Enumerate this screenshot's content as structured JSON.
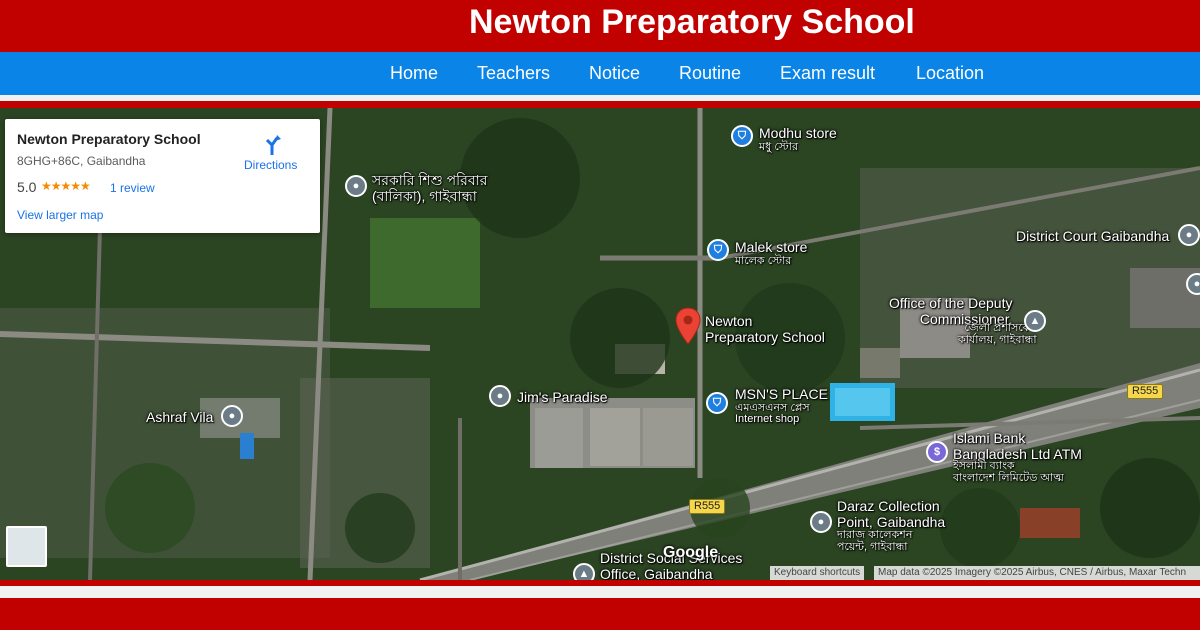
{
  "header": {
    "title": "Newton Preparatory School"
  },
  "nav": {
    "items": [
      "Home",
      "Teachers",
      "Notice",
      "Routine",
      "Exam result",
      "Location"
    ]
  },
  "colors": {
    "header_red": "#c10000",
    "nav_blue": "#0a84e6",
    "link_blue": "#1a73e8",
    "star_orange": "#f58b00",
    "pin_red": "#ea4335"
  },
  "infobox": {
    "name": "Newton Preparatory School",
    "address": "8GHG+86C, Gaibandha",
    "rating": "5.0",
    "stars": "★★★★★",
    "reviews": "1 review",
    "larger_map": "View larger map",
    "directions": "Directions",
    "directions_icon": "directions-icon"
  },
  "map": {
    "places": {
      "modhu_store": {
        "name": "Modhu store",
        "sub": "মধু স্টোর",
        "icon": "shopping-icon"
      },
      "sarkari": {
        "name": "সরকারি শিশু পরিবার\n(বালিকা), গাইবান্ধা",
        "icon": "place-icon"
      },
      "malek_store": {
        "name": "Malek store",
        "sub": "মালেক স্টোর",
        "icon": "shopping-icon"
      },
      "district_court": {
        "name": "District Court Gaibandha",
        "icon": "place-icon"
      },
      "deputy_commissioner": {
        "name": "Office of the Deputy\nCommissioner,",
        "sub": "জেলা প্রশাসকের\nকার্যালয়, গাইবান্ধা",
        "icon": "government-icon"
      },
      "newton": {
        "name": "Newton\nPreparatory School",
        "icon": "red-marker-icon"
      },
      "jims_paradise": {
        "name": "Jim's Paradise",
        "icon": "place-icon"
      },
      "msns_place": {
        "name": "MSN'S PLACE",
        "sub": "এমএসএনস প্লেস",
        "sub2": "Internet shop",
        "icon": "shopping-icon"
      },
      "ashraf_vila": {
        "name": "Ashraf Vila",
        "icon": "place-icon"
      },
      "islami_bank": {
        "name": "Islami Bank\nBangladesh Ltd ATM",
        "sub": "ইসলামী ব্যাংক\nবাংলাদেশ লিমিটেড আত্ম",
        "icon": "atm-icon"
      },
      "daraz": {
        "name": "Daraz Collection\nPoint, Gaibandha",
        "sub": "দারাজ কালেকশন\nপয়েন্ট, গাইবান্ধা",
        "icon": "place-icon"
      },
      "district_social": {
        "name": "District Social Services\nOffice, Gaibandha",
        "icon": "government-icon"
      }
    },
    "roads": {
      "r555_a": "R555",
      "r555_b": "R555"
    },
    "google_logo": "Google",
    "keyboard_shortcuts": "Keyboard shortcuts",
    "map_data": "Map data ©2025 Imagery ©2025 Airbus, CNES / Airbus, Maxar Techn"
  },
  "footer": {
    "item_a": "",
    "item_b": ""
  }
}
